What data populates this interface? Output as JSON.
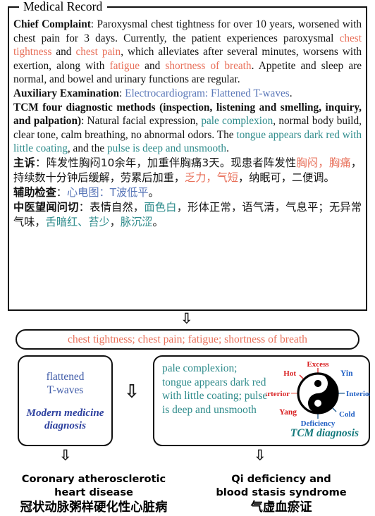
{
  "record": {
    "legend": "Medical Record",
    "chief_complaint_label": "Chief Complaint",
    "chief_complaint": {
      "seg1": ": Paroxysmal chest tightness for over 10 years, worsened with chest pain for 3 days. Currently, the patient experiences paroxysmal ",
      "hl1": "chest tightness",
      "seg2": " and ",
      "hl2": "chest pain",
      "seg3": ", which alleviates after several minutes, worsens with exertion, along with ",
      "hl3": "fatigue",
      "seg4": " and ",
      "hl4": "shortness of breath",
      "seg5": ". Appetite and sleep are normal, and bowel and urinary functions are regular."
    },
    "auxiliary_label": "Auxiliary Examination",
    "auxiliary": {
      "seg1": ": ",
      "hl1": "Electrocardiogram: Flattened T-waves",
      "seg2": "."
    },
    "tcm_label": "TCM four diagnostic methods (inspection, listening  and smelling, inquiry, and palpation)",
    "tcm": {
      "seg1": ": Natural facial expression, ",
      "hl1": "pale complexion",
      "seg2": ", normal body build, clear tone, calm breathing, no abnormal odors. The ",
      "hl2": "tongue appears dark red with little coating",
      "seg3": ", and the ",
      "hl3": "pulse is deep and unsmooth",
      "seg4": "."
    },
    "zh_chief_label": "主诉",
    "zh_chief": {
      "seg1": "：阵发性胸闷10余年，加重伴胸痛3天。现患者阵发性",
      "hl1": "胸闷，胸痛",
      "seg2": "，持续数十分钟后缓解，劳累后加重，",
      "hl2": "乏力，气短",
      "seg3": "，纳眠可，二便调。"
    },
    "zh_aux_label": "辅助检查",
    "zh_aux": {
      "seg1": "：",
      "hl1": "心电图：T波低平",
      "seg2": "。"
    },
    "zh_tcm_label": "中医望闻问切",
    "zh_tcm": {
      "seg1": "：表情自然，",
      "hl1": "面色白",
      "seg2": "，形体正常，语气清，气息平；无异常气味，",
      "hl2": "舌暗红、苔少",
      "seg3": "，",
      "hl3": "脉沉涩",
      "seg4": "。"
    }
  },
  "arrows": {
    "glyph": "⇩"
  },
  "symptom_pill": {
    "text": "chest tightness; chest pain; fatigue; shortness of breath"
  },
  "modern_panel": {
    "evidence": "flattened\nT-waves",
    "evidence_line1": "flattened",
    "evidence_line2": "T-waves",
    "label_line1": "Modern medicine",
    "label_line2": "diagnosis"
  },
  "tcm_panel": {
    "evidence": "pale complexion; tongue appears dark red with little coating; pulse is deep and unsmooth",
    "label": "TCM diagnosis"
  },
  "yinyang": {
    "top": "Excess",
    "upper_left": "Hot",
    "left": "Exrterior",
    "lower_left": "Yang",
    "upper_right": "Yin",
    "right": "Interior",
    "lower_right": "Cold",
    "bottom": "Deficiency"
  },
  "conclusions": {
    "left_en_line1": "Coronary atherosclerotic",
    "left_en_line2": "heart disease",
    "left_zh": "冠状动脉粥样硬化性心脏病",
    "right_en_line1": "Qi deficiency and",
    "right_en_line2": "blood stasis syndrome",
    "right_zh": "气虚血瘀证"
  },
  "colors": {
    "symptom_red": "#e8705a",
    "tcm_teal": "#2e8b8b",
    "modern_blue": "#5a77b8",
    "yang_red": "#d81f20",
    "yin_blue": "#1f5fc4",
    "border": "#111111"
  }
}
